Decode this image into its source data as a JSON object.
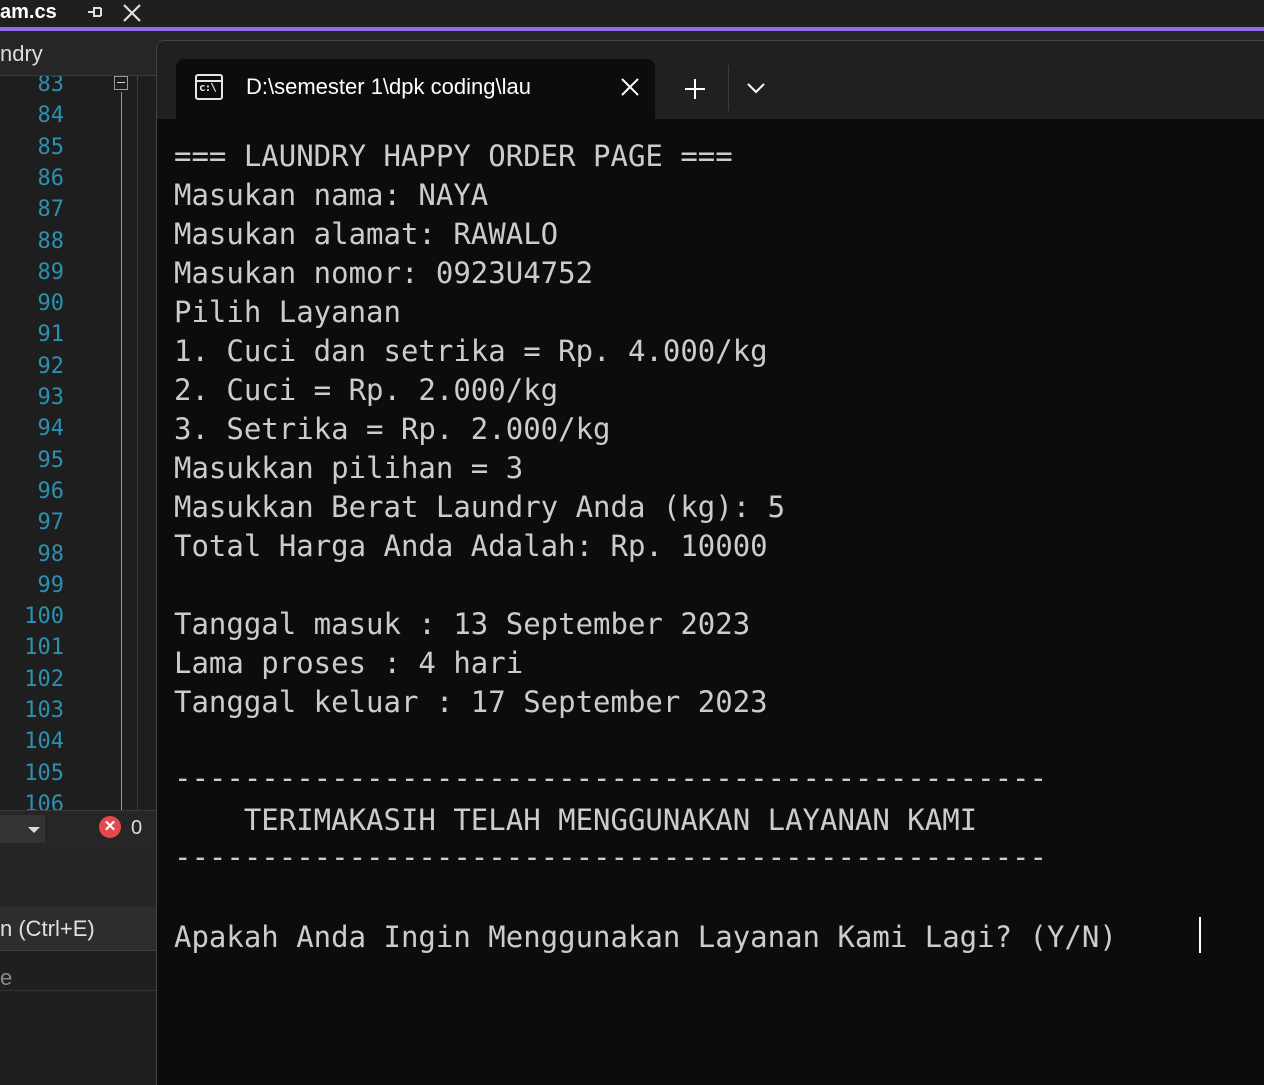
{
  "ide": {
    "tab_title": "am.cs",
    "nav_label": "ndry",
    "line_numbers": [
      "83",
      "84",
      "85",
      "86",
      "87",
      "88",
      "89",
      "90",
      "91",
      "92",
      "93",
      "94",
      "95",
      "96",
      "97",
      "98",
      "99",
      "100",
      "101",
      "102",
      "103",
      "104",
      "105",
      "106"
    ],
    "error_count": "0",
    "search_hint": "n (Ctrl+E)",
    "panel_row": "e",
    "error_glyph": "✕"
  },
  "terminal": {
    "tab_title": "D:\\semester 1\\dpk coding\\lau",
    "tab_icon_text": "c:\\",
    "lines": [
      "=== LAUNDRY HAPPY ORDER PAGE ===",
      "Masukan nama: NAYA",
      "Masukan alamat: RAWALO",
      "Masukan nomor: 0923U4752",
      "Pilih Layanan",
      "1. Cuci dan setrika = Rp. 4.000/kg",
      "2. Cuci = Rp. 2.000/kg",
      "3. Setrika = Rp. 2.000/kg",
      "Masukkan pilihan = 3",
      "Masukkan Berat Laundry Anda (kg): 5",
      "Total Harga Anda Adalah: Rp. 10000",
      "Tanggal masuk : 13 September 2023",
      "Lama proses : 4 hari",
      "Tanggal keluar : 17 September 2023",
      "--------------------------------------------------",
      "    TERIMAKASIH TELAH MENGGUNAKAN LAYANAN KAMI",
      "--------------------------------------------------",
      "Apakah Anda Ingin Menggunakan Layanan Kami Lagi? (Y/N)"
    ]
  },
  "colors": {
    "accent": "#8f6be8",
    "line_number": "#2b91af",
    "terminal_bg": "#0c0c0c",
    "terminal_text": "#cccccc",
    "error": "#e5484d"
  }
}
